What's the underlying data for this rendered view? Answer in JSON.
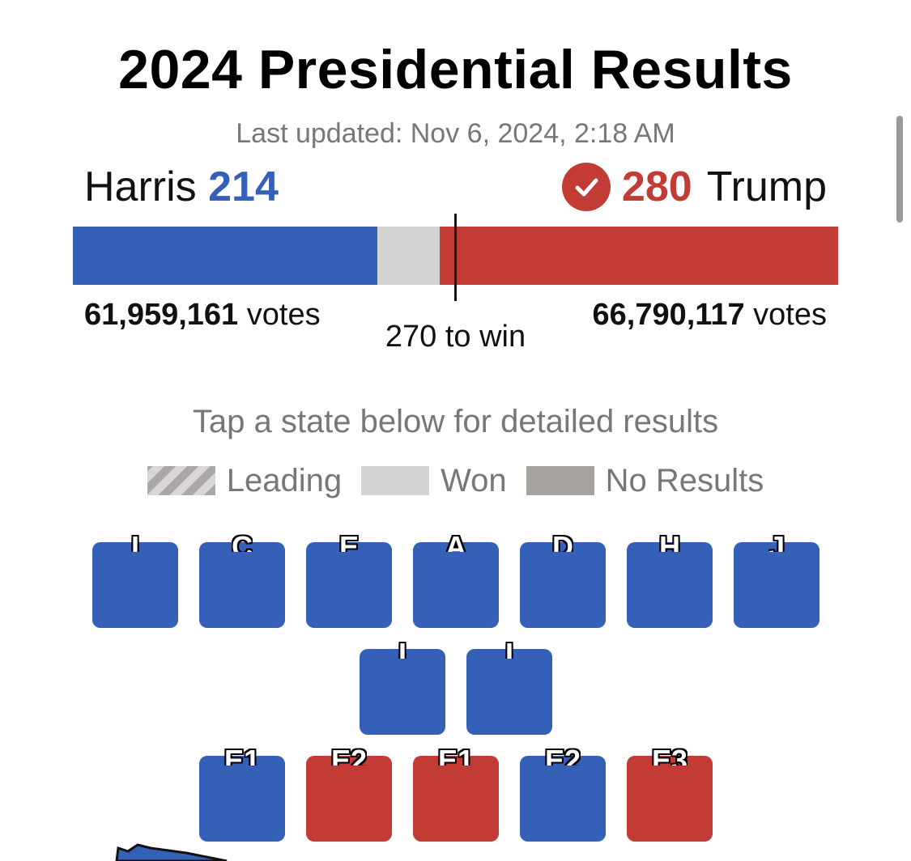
{
  "title": "2024 Presidential Results",
  "last_updated": "Last updated: Nov 6, 2024, 2:18 AM",
  "harris": {
    "name": "Harris",
    "electoral_votes": "214",
    "popular_votes": "61,959,161",
    "votes_label": "votes",
    "color": "#3560b8"
  },
  "trump": {
    "name": "Trump",
    "electoral_votes": "280",
    "popular_votes": "66,790,117",
    "votes_label": "votes",
    "color": "#c23b35",
    "winner_icon": "check-circle-icon"
  },
  "bar": {
    "harris_ev": 214,
    "trump_ev": 280,
    "total_ev": 538,
    "to_win": "270 to win"
  },
  "tap_hint": "Tap a state below for detailed results",
  "legend": [
    {
      "key": "leading",
      "label": "Leading"
    },
    {
      "key": "won",
      "label": "Won"
    },
    {
      "key": "none",
      "label": "No Results"
    }
  ],
  "tiles": [
    {
      "label": "I",
      "party": "dem"
    },
    {
      "label": "C",
      "party": "dem"
    },
    {
      "label": "E",
      "party": "dem"
    },
    {
      "label": "A",
      "party": "dem"
    },
    {
      "label": "D",
      "party": "dem"
    },
    {
      "label": "H",
      "party": "dem"
    },
    {
      "label": "J",
      "party": "dem"
    },
    {
      "label": "I",
      "party": "dem"
    },
    {
      "label": "I",
      "party": "dem"
    },
    {
      "label": "E1",
      "party": "dem"
    },
    {
      "label": "E2",
      "party": "rep"
    },
    {
      "label": "E1",
      "party": "rep"
    },
    {
      "label": "E2",
      "party": "dem"
    },
    {
      "label": "E3",
      "party": "rep"
    }
  ]
}
